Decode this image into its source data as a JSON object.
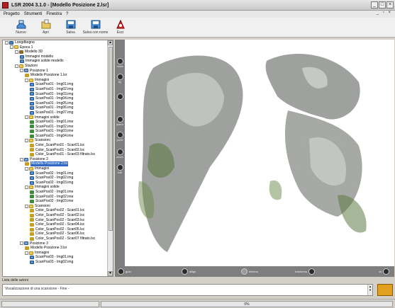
{
  "window": {
    "title": "LSR 2004 3.1.0 - [Modello Posizione 2.lsr]",
    "controls": [
      "_",
      "□",
      "×"
    ]
  },
  "menu": {
    "items": [
      "Progetto",
      "Strumenti",
      "Finestra",
      "?"
    ],
    "mdi_controls": "_ ▫ ×"
  },
  "toolbar": {
    "buttons": [
      {
        "label": "Nuovo",
        "icon": "new-project-icon",
        "color": "#4a8fd8"
      },
      {
        "label": "Apri",
        "icon": "open-folder-icon",
        "color": "#d9b84a"
      },
      {
        "label": "Salva",
        "icon": "save-icon",
        "color": "#4a8fd8"
      },
      {
        "label": "Salva con nome",
        "icon": "save-as-icon",
        "color": "#4a8fd8"
      },
      {
        "label": "Esci",
        "icon": "exit-icon",
        "color": "#d03030"
      }
    ]
  },
  "tree": {
    "nodes": [
      {
        "label": "Longdbogno",
        "depth": 0,
        "icon": "root",
        "box": "-"
      },
      {
        "label": "Epoca 1",
        "depth": 1,
        "icon": "folder",
        "box": "-"
      },
      {
        "label": "Modello 3D",
        "depth": 2,
        "icon": "model",
        "box": "-"
      },
      {
        "label": "Immagini modello",
        "depth": 3,
        "icon": "img",
        "box": ""
      },
      {
        "label": "Immagini solide modello",
        "depth": 3,
        "icon": "img",
        "box": ""
      },
      {
        "label": "Stazioni",
        "depth": 2,
        "icon": "folder",
        "box": "-"
      },
      {
        "label": "Posizione 1",
        "depth": 3,
        "icon": "pos",
        "box": "-"
      },
      {
        "label": "Modello Posizione 1.lsr",
        "depth": 4,
        "icon": "scan",
        "box": ""
      },
      {
        "label": "Immagini",
        "depth": 4,
        "icon": "folder",
        "box": "-"
      },
      {
        "label": "ScanPos01 - Img01.img",
        "depth": 5,
        "icon": "img",
        "box": ""
      },
      {
        "label": "ScanPos01 - Img02.img",
        "depth": 5,
        "icon": "img",
        "box": ""
      },
      {
        "label": "ScanPos01 - Img03.img",
        "depth": 5,
        "icon": "img",
        "box": ""
      },
      {
        "label": "ScanPos01 - Img04.img",
        "depth": 5,
        "icon": "img",
        "box": ""
      },
      {
        "label": "ScanPos01 - Img05.img",
        "depth": 5,
        "icon": "img",
        "box": ""
      },
      {
        "label": "ScanPos01 - Img06.img",
        "depth": 5,
        "icon": "img",
        "box": ""
      },
      {
        "label": "ScanPos01 - Img07.img",
        "depth": 5,
        "icon": "img",
        "box": ""
      },
      {
        "label": "Immagini solide",
        "depth": 4,
        "icon": "folder",
        "box": "-"
      },
      {
        "label": "ScanPos01 - Img01.ime",
        "depth": 5,
        "icon": "eye",
        "box": ""
      },
      {
        "label": "ScanPos01 - Img02.ime",
        "depth": 5,
        "icon": "eye",
        "box": ""
      },
      {
        "label": "ScanPos01 - Img03.ime",
        "depth": 5,
        "icon": "eye",
        "box": ""
      },
      {
        "label": "ScanPos01 - Img04.ime",
        "depth": 5,
        "icon": "eye",
        "box": ""
      },
      {
        "label": "Scansioni",
        "depth": 4,
        "icon": "folder",
        "box": "-"
      },
      {
        "label": "Color_ScanPos01 - Scan01.lsc",
        "depth": 5,
        "icon": "scan",
        "box": ""
      },
      {
        "label": "Color_ScanPos01 - Scan02.lsc",
        "depth": 5,
        "icon": "scan",
        "box": ""
      },
      {
        "label": "Color_ScanPos01 - Scan03 filtrato.lsc",
        "depth": 5,
        "icon": "scan",
        "box": ""
      },
      {
        "label": "Posizione 2",
        "depth": 3,
        "icon": "pos",
        "box": "-"
      },
      {
        "label": "Modello Posizione 2.lsr",
        "depth": 4,
        "icon": "scan",
        "box": "",
        "selected": true
      },
      {
        "label": "Immagini",
        "depth": 4,
        "icon": "folder",
        "box": "-"
      },
      {
        "label": "ScanPos02 - Img01.img",
        "depth": 5,
        "icon": "img",
        "box": ""
      },
      {
        "label": "ScanPos02 - Img02.img",
        "depth": 5,
        "icon": "img",
        "box": ""
      },
      {
        "label": "ScanPos02 - Img03.img",
        "depth": 5,
        "icon": "img",
        "box": ""
      },
      {
        "label": "Immagini solide",
        "depth": 4,
        "icon": "folder",
        "box": "-"
      },
      {
        "label": "ScanPos02 - Img01.ime",
        "depth": 5,
        "icon": "eye",
        "box": ""
      },
      {
        "label": "ScanPos02 - Img02.ime",
        "depth": 5,
        "icon": "eye",
        "box": ""
      },
      {
        "label": "ScanPos02 - Img03.ime",
        "depth": 5,
        "icon": "eye",
        "box": ""
      },
      {
        "label": "Scansioni",
        "depth": 4,
        "icon": "folder",
        "box": "-"
      },
      {
        "label": "Color_ScanPos02 - Scan01.lsc",
        "depth": 5,
        "icon": "scan",
        "box": ""
      },
      {
        "label": "Color_ScanPos02 - Scan02.lsc",
        "depth": 5,
        "icon": "scan",
        "box": ""
      },
      {
        "label": "Color_ScanPos02 - Scan03.lsc",
        "depth": 5,
        "icon": "scan",
        "box": ""
      },
      {
        "label": "Color_ScanPos02 - Scan04.lsc",
        "depth": 5,
        "icon": "scan",
        "box": ""
      },
      {
        "label": "Color_ScanPos02 - Scan05.lsc",
        "depth": 5,
        "icon": "scan",
        "box": ""
      },
      {
        "label": "Color_ScanPos02 - Scan06.lsc",
        "depth": 5,
        "icon": "scan",
        "box": ""
      },
      {
        "label": "Color_ScanPos02 - Scan07 filtrato.lsc",
        "depth": 5,
        "icon": "scan",
        "box": ""
      },
      {
        "label": "Posizione 3",
        "depth": 3,
        "icon": "pos",
        "box": "-"
      },
      {
        "label": "Modello Posizione 3.lsr",
        "depth": 4,
        "icon": "scan",
        "box": ""
      },
      {
        "label": "Immagini",
        "depth": 4,
        "icon": "folder",
        "box": "-"
      },
      {
        "label": "ScanPos03 - Img01.img",
        "depth": 5,
        "icon": "img",
        "box": ""
      },
      {
        "label": "ScanPos03 - Img02.img",
        "depth": 5,
        "icon": "img",
        "box": ""
      }
    ]
  },
  "side_tools": [
    {
      "label": "ruota",
      "icon": "rotate-icon"
    },
    {
      "label": "fly",
      "icon": "fly-icon"
    },
    {
      "label": "",
      "icon": "separator-icon"
    },
    {
      "label": "piano",
      "icon": "plane-icon"
    },
    {
      "label": "punti",
      "icon": "points-icon"
    },
    {
      "label": "zoom",
      "icon": "zoom-icon"
    },
    {
      "label": "rulli",
      "icon": "rulli-icon"
    }
  ],
  "bottom_tools": [
    {
      "label": "gufo",
      "icon": "gufo-icon",
      "enabled": true
    },
    {
      "label": "allign",
      "icon": "align-icon",
      "enabled": true
    },
    {
      "label": "elimina",
      "icon": "delete-icon",
      "enabled": false
    },
    {
      "label": "trasforma",
      "icon": "transform-icon",
      "enabled": true
    },
    {
      "label": "ok",
      "icon": "ok-icon",
      "enabled": true
    }
  ],
  "actions": {
    "label": "Lista delle azioni",
    "text": "Visualizzazione di una scansione - Fine -"
  },
  "status": {
    "progress": "0%"
  },
  "colors": {
    "viewer_bg": "#ffffff",
    "tool_panel": "#7e7e7e",
    "selection": "#316ac5"
  }
}
